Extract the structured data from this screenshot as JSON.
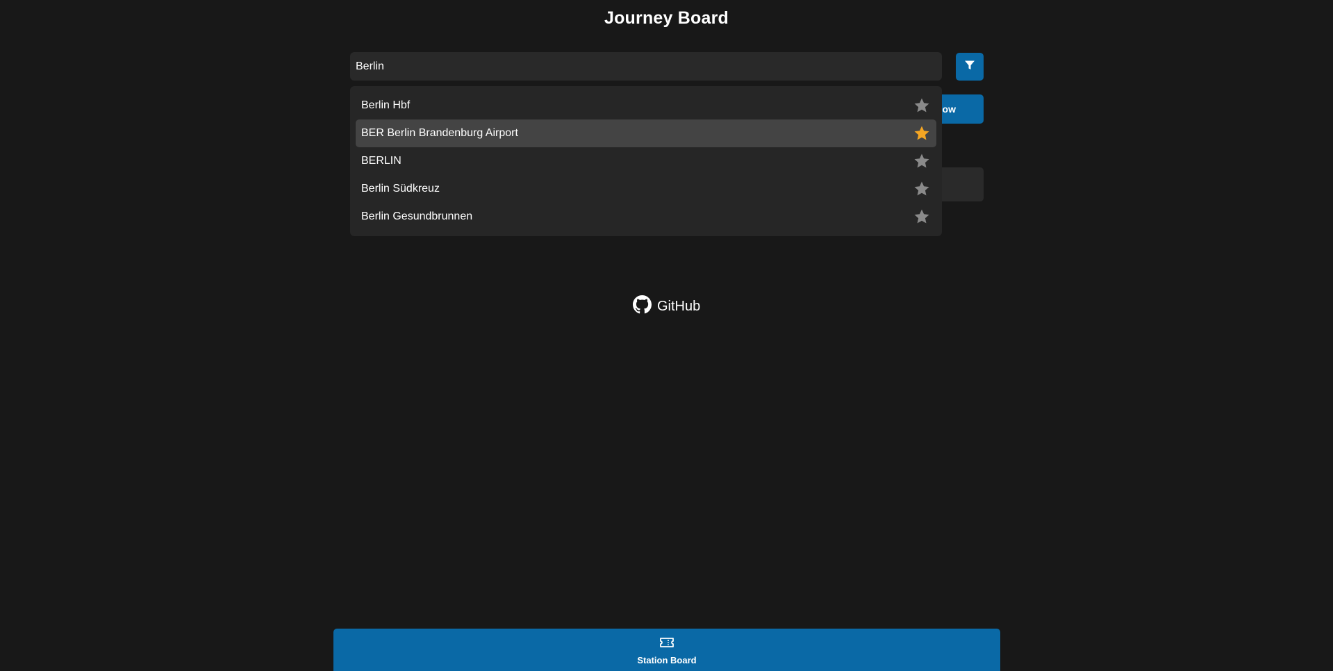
{
  "app": {
    "title": "Journey Board"
  },
  "search": {
    "value": "Berlin",
    "placeholder": ""
  },
  "controls": {
    "filter_icon": "filter-icon",
    "now_label": "ow"
  },
  "suggestions": [
    {
      "label": "Berlin Hbf",
      "favorite": false
    },
    {
      "label": "BER Berlin Brandenburg Airport",
      "favorite": true
    },
    {
      "label": "BERLIN",
      "favorite": false
    },
    {
      "label": "Berlin Südkreuz",
      "favorite": false
    },
    {
      "label": "Berlin Gesundbrunnen",
      "favorite": false
    }
  ],
  "footer": {
    "github_label": "GitHub",
    "github_icon": "github-icon"
  },
  "bottom_nav": {
    "station_board_label": "Station Board",
    "station_board_icon": "ticket-icon"
  },
  "colors": {
    "background": "#181818",
    "accent": "#0a69a6",
    "favorite_star": "#f5a623",
    "star_inactive": "#8a8a8a"
  }
}
